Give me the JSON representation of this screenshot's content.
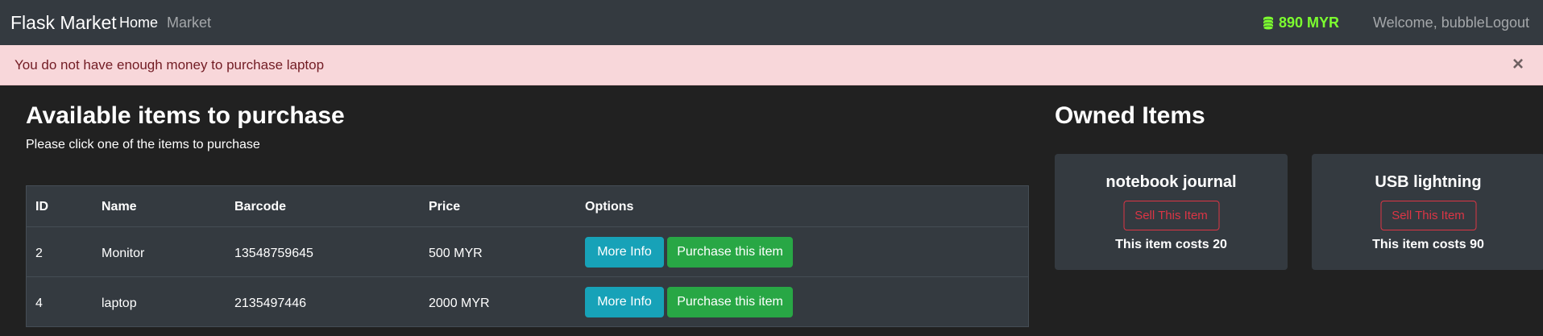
{
  "navbar": {
    "brand": "Flask Market",
    "links": [
      {
        "label": "Home"
      },
      {
        "label": "Market"
      }
    ],
    "budget": "890 MYR",
    "budget_icon": "coins-icon",
    "budget_color": "#7cff2f",
    "welcome": "Welcome, bubble",
    "logout": "Logout"
  },
  "alert": {
    "message": "You do not have enough money to purchase laptop",
    "close": "×",
    "background": "#f8d7da"
  },
  "available": {
    "title": "Available items to purchase",
    "subtitle": "Please click one of the items to purchase",
    "columns": [
      "ID",
      "Name",
      "Barcode",
      "Price",
      "Options"
    ],
    "rows": [
      {
        "id": "2",
        "name": "Monitor",
        "barcode": "13548759645",
        "price": "500 MYR",
        "info_label": "More Info",
        "purchase_label": "Purchase this item"
      },
      {
        "id": "4",
        "name": "laptop",
        "barcode": "2135497446",
        "price": "2000 MYR",
        "info_label": "More Info",
        "purchase_label": "Purchase this item"
      }
    ]
  },
  "owned": {
    "title": "Owned Items",
    "items": [
      {
        "name": "notebook journal",
        "sell_label": "Sell This Item",
        "cost_text": "This item costs 20"
      },
      {
        "name": "USB lightning",
        "sell_label": "Sell This Item",
        "cost_text": "This item costs 90"
      }
    ]
  }
}
